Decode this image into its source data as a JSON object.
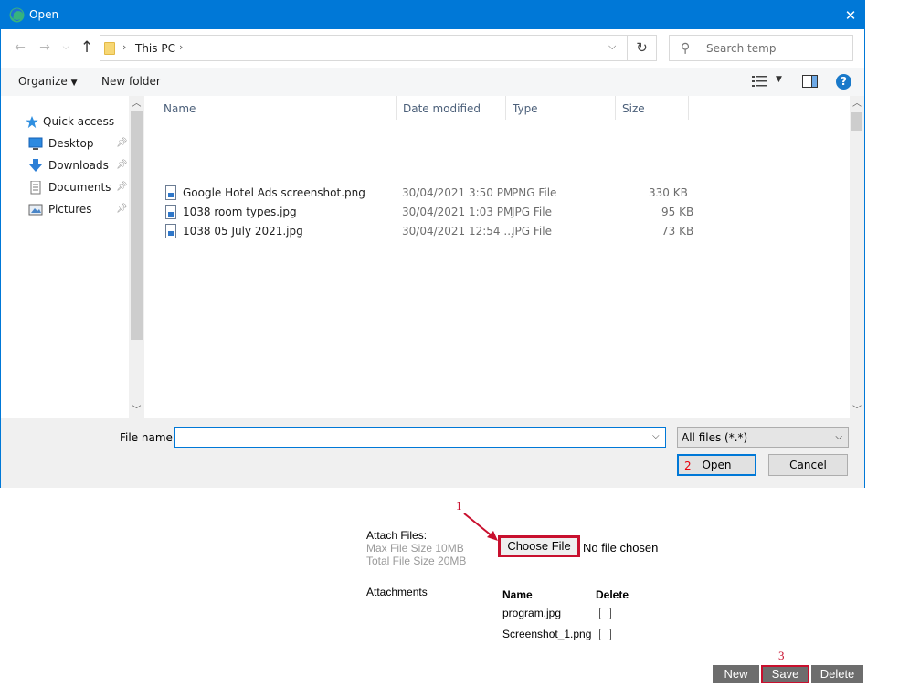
{
  "dialog": {
    "title": "Open",
    "address": {
      "location": "This PC",
      "search_placeholder": "Search temp"
    },
    "toolbar": {
      "organize_label": "Organize",
      "new_folder_label": "New folder"
    },
    "nav": {
      "items": [
        {
          "label": "Quick access",
          "icon": "star-icon"
        },
        {
          "label": "Desktop",
          "icon": "desktop-icon"
        },
        {
          "label": "Downloads",
          "icon": "download-icon"
        },
        {
          "label": "Documents",
          "icon": "document-icon"
        },
        {
          "label": "Pictures",
          "icon": "pictures-icon"
        }
      ]
    },
    "columns": [
      "Name",
      "Date modified",
      "Type",
      "Size"
    ],
    "files": [
      {
        "name": "Google Hotel Ads screenshot.png",
        "date": "30/04/2021 3:50 PM",
        "type": "PNG File",
        "size": "330 KB"
      },
      {
        "name": "1038 room types.jpg",
        "date": "30/04/2021 1:03 PM",
        "type": "JPG File",
        "size": "95 KB"
      },
      {
        "name": "1038 05 July 2021.jpg",
        "date": "30/04/2021 12:54 ...",
        "type": "JPG File",
        "size": "73 KB"
      }
    ],
    "filename_label": "File name:",
    "filename_value": "",
    "filter_value": "All files (*.*)",
    "open_label": "Open",
    "cancel_label": "Cancel",
    "step_open": "2"
  },
  "form": {
    "attach_label": "Attach Files:",
    "max_file_size": "Max File Size 10MB",
    "total_file_size": "Total File Size 20MB",
    "choose_file_label": "Choose File",
    "no_file_text": "No file chosen",
    "step_choose": "1",
    "attachments_label": "Attachments",
    "attach_columns": {
      "name": "Name",
      "delete": "Delete"
    },
    "attachments": [
      {
        "name": "program.jpg"
      },
      {
        "name": "Screenshot_1.png"
      }
    ],
    "buttons": {
      "new": "New",
      "save": "Save",
      "delete": "Delete"
    },
    "step_save": "3"
  },
  "colors": {
    "accent": "#0078d7",
    "highlight": "#c8102e",
    "button_grey": "#6d6d6d"
  }
}
